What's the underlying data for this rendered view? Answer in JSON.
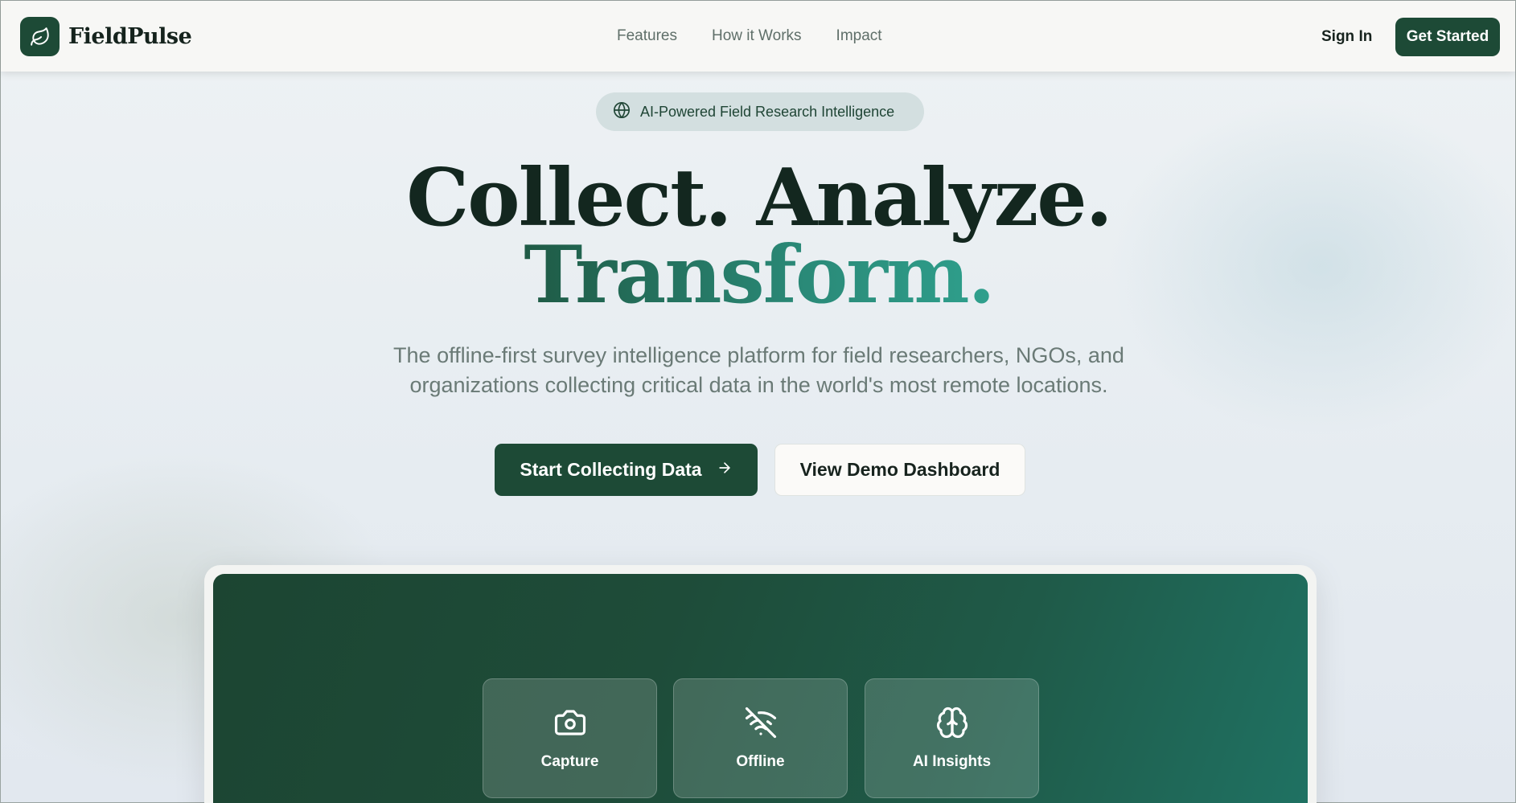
{
  "brand": {
    "name": "FieldPulse",
    "logo_icon": "leaf-icon"
  },
  "nav": {
    "links": [
      "Features",
      "How it Works",
      "Impact"
    ],
    "sign_in": "Sign In",
    "get_started": "Get Started"
  },
  "hero": {
    "badge": {
      "icon": "globe-icon",
      "text": "AI-Powered Field Research Intelligence"
    },
    "headline_line1": "Collect. Analyze.",
    "headline_line2": "Transform.",
    "subtitle_line1": "The offline-first survey intelligence platform for field researchers, NGOs, and",
    "subtitle_line2": "organizations collecting critical data in the world's most remote locations.",
    "primary_cta": "Start Collecting Data",
    "secondary_cta": "View Demo Dashboard"
  },
  "preview": {
    "features": [
      {
        "icon": "camera-icon",
        "label": "Capture"
      },
      {
        "icon": "wifi-off-icon",
        "label": "Offline"
      },
      {
        "icon": "brain-icon",
        "label": "AI Insights"
      }
    ]
  },
  "colors": {
    "brand_dark": "#1d4a36",
    "accent_teal": "#2a8c7a",
    "headline": "#13271f",
    "muted_text": "#6a7a76"
  }
}
